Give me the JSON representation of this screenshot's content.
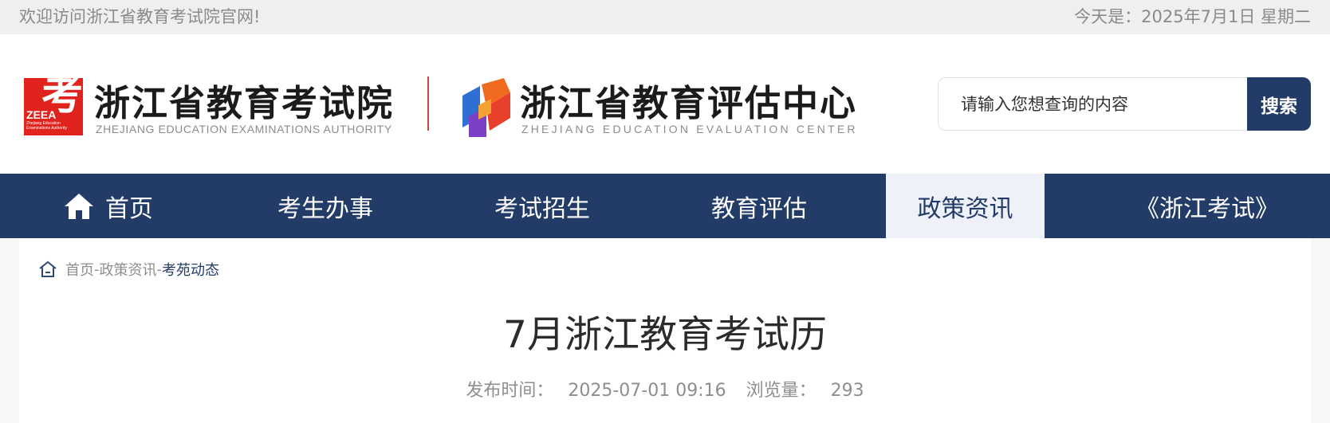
{
  "topbar": {
    "welcome": "欢迎访问浙江省教育考试院官网!",
    "date": "今天是：2025年7月1日 星期二"
  },
  "header": {
    "org1": {
      "logo_char": "考",
      "logo_abbr": "ZEEA",
      "logo_small": "Zhejiang Education Examinations Authority",
      "name_cn": "浙江省教育考试院",
      "name_en": "ZHEJIANG EDUCATION EXAMINATIONS AUTHORITY"
    },
    "org2": {
      "name_cn": "浙江省教育评估中心",
      "name_en": "ZHEJIANG EDUCATION EVALUATION CENTER"
    },
    "search": {
      "placeholder": "请输入您想查询的内容",
      "button": "搜索"
    }
  },
  "nav": {
    "items": [
      {
        "label": "首页",
        "icon": "home-icon"
      },
      {
        "label": "考生办事"
      },
      {
        "label": "考试招生"
      },
      {
        "label": "教育评估"
      },
      {
        "label": "政策资讯",
        "active": true
      },
      {
        "label": "《浙江考试》"
      }
    ]
  },
  "breadcrumb": {
    "icon": "home-outline-icon",
    "home": "首页",
    "sep": "-",
    "section": "政策资讯",
    "current": "考苑动态"
  },
  "article": {
    "title": "7月浙江教育考试历",
    "publish_label": "发布时间：",
    "publish_time": "2025-07-01 09:16",
    "views_label": "浏览量：",
    "views": "293"
  },
  "colors": {
    "brand_navy": "#233c67",
    "brand_red": "#e0241d"
  }
}
